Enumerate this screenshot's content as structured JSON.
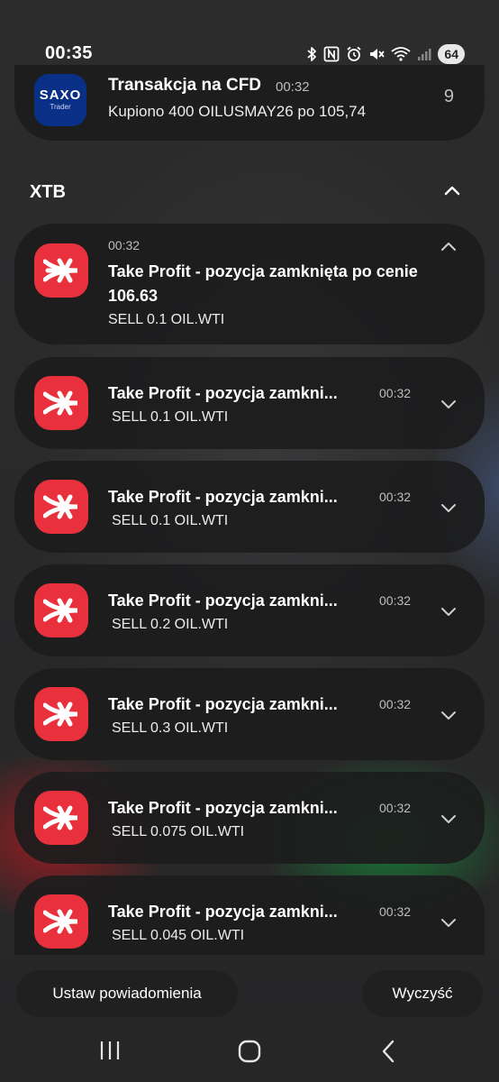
{
  "status_bar": {
    "time": "00:35",
    "battery": "64",
    "icons": [
      "bluetooth-icon",
      "nfc-icon",
      "alarm-icon",
      "mute-icon",
      "wifi-calling-icon",
      "signal-icon"
    ]
  },
  "saxo_notification": {
    "app_logo_line1": "SAXO",
    "app_logo_line2": "Trader",
    "title": "Transakcja na CFD",
    "time": "00:32",
    "body": "Kupiono 400 OILUSMAY26 po 105,74",
    "count": "9"
  },
  "xtb_group": {
    "name": "XTB",
    "expanded_notification": {
      "time": "00:32",
      "title": "Take Profit - pozycja zamknięta po cenie 106.63",
      "body": "SELL 0.1 OIL.WTI"
    },
    "notifications": [
      {
        "title": "Take Profit - pozycja zamkni...",
        "time": "00:32",
        "body": "SELL 0.1 OIL.WTI"
      },
      {
        "title": "Take Profit - pozycja zamkni...",
        "time": "00:32",
        "body": "SELL 0.1 OIL.WTI"
      },
      {
        "title": "Take Profit - pozycja zamkni...",
        "time": "00:32",
        "body": "SELL 0.2 OIL.WTI"
      },
      {
        "title": "Take Profit - pozycja zamkni...",
        "time": "00:32",
        "body": "SELL 0.3 OIL.WTI"
      },
      {
        "title": "Take Profit - pozycja zamkni...",
        "time": "00:32",
        "body": "SELL 0.075 OIL.WTI"
      },
      {
        "title": "Take Profit - pozycja zamkni...",
        "time": "00:32",
        "body": "SELL 0.045 OIL.WTI"
      }
    ]
  },
  "actions": {
    "settings_label": "Ustaw powiadomienia",
    "clear_label": "Wyczyść"
  },
  "colors": {
    "xtb_brand": "#e8313c",
    "saxo_brand": "#0a2f86"
  }
}
